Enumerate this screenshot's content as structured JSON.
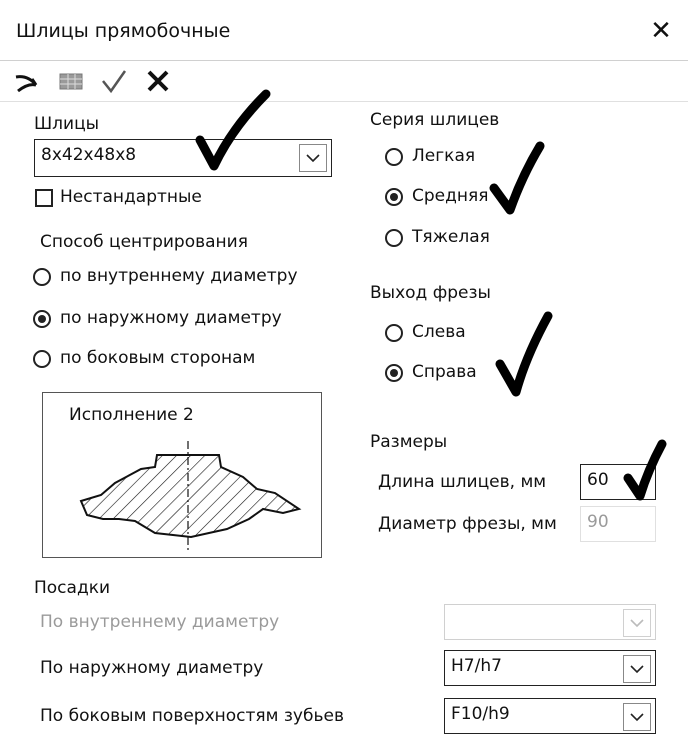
{
  "window": {
    "title": "Шлицы прямобочные"
  },
  "toolbar": {
    "buttons": [
      {
        "icon": "back-arrow-icon"
      },
      {
        "icon": "table-icon"
      },
      {
        "icon": "checkmark-icon"
      },
      {
        "icon": "cross-icon"
      }
    ]
  },
  "splines": {
    "label": "Шлицы",
    "value": "8x42x48x8",
    "nonstandard_label": "Нестандартные",
    "nonstandard_checked": false
  },
  "centering": {
    "label": "Способ центрирования",
    "options": [
      "по внутреннему диаметру",
      "по наружному диаметру",
      "по боковым сторонам"
    ],
    "selected": 1
  },
  "preview": {
    "label": "Исполнение 2"
  },
  "series": {
    "label": "Серия шлицев",
    "options": [
      "Легкая",
      "Средняя",
      "Тяжелая"
    ],
    "selected": 1
  },
  "cutter_exit": {
    "label": "Выход фрезы",
    "options": [
      "Слева",
      "Справа"
    ],
    "selected": 1
  },
  "sizes": {
    "label": "Размеры",
    "length_label": "Длина шлицев, мм",
    "length_value": "60",
    "diameter_label": "Диаметр фрезы, мм",
    "diameter_value": "90"
  },
  "fits": {
    "label": "Посадки",
    "inner_label": "По внутреннему диаметру",
    "inner_value": "",
    "outer_label": "По наружному диаметру",
    "outer_value": "H7/h7",
    "side_label": "По боковым поверхностям зубьев",
    "side_value": "F10/h9"
  }
}
